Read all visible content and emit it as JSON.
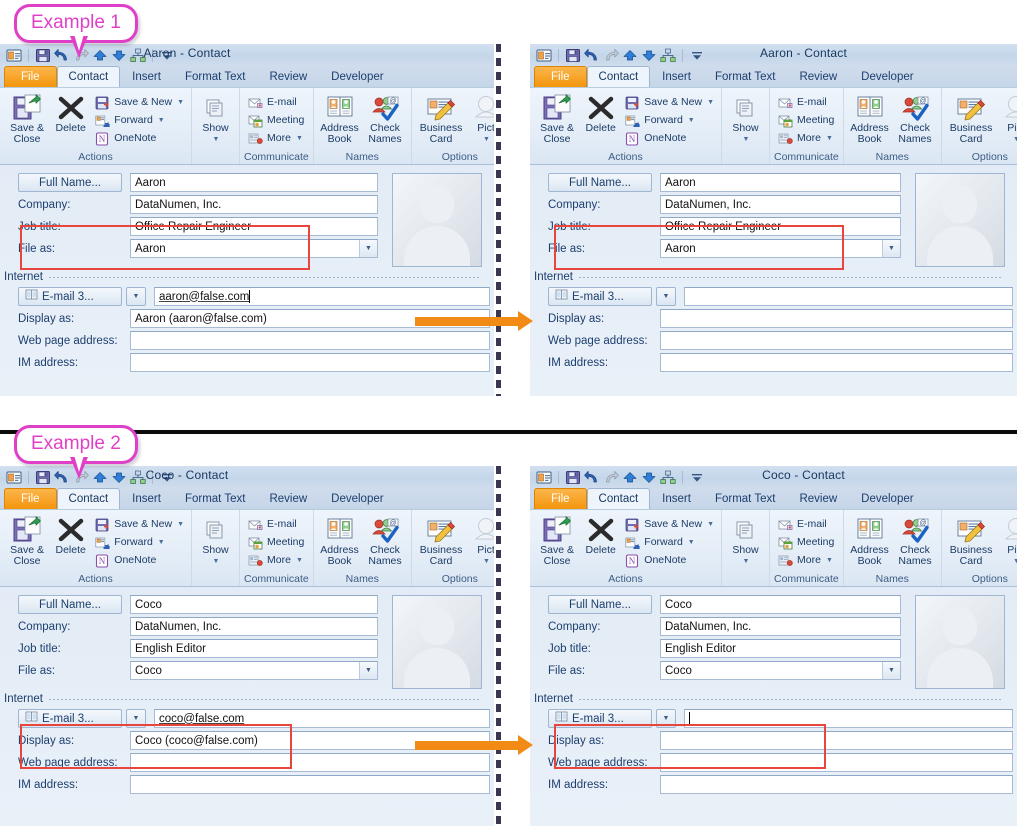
{
  "page": {
    "background": "#ffffff",
    "accent_orange": "#f28a16",
    "accent_magenta": "#e040c8",
    "highlight_red": "#e8453c"
  },
  "callouts": [
    {
      "label": "Example 1"
    },
    {
      "label": "Example 2"
    }
  ],
  "window_chrome": {
    "quick_access": [
      {
        "name": "contact-card-icon",
        "glyph": "contact"
      },
      {
        "name": "save-icon",
        "glyph": "save"
      },
      {
        "name": "undo-icon",
        "glyph": "undo"
      },
      {
        "name": "redo-icon",
        "glyph": "redo"
      },
      {
        "name": "previous-item-icon",
        "glyph": "up"
      },
      {
        "name": "next-item-icon",
        "glyph": "down"
      },
      {
        "name": "hierarchy-icon",
        "glyph": "hierarchy"
      },
      {
        "name": "customize-qat-icon",
        "glyph": "more"
      }
    ],
    "tabs": [
      {
        "label": "File",
        "style": "file"
      },
      {
        "label": "Contact",
        "style": "active"
      },
      {
        "label": "Insert",
        "style": "normal"
      },
      {
        "label": "Format Text",
        "style": "normal"
      },
      {
        "label": "Review",
        "style": "normal"
      },
      {
        "label": "Developer",
        "style": "normal"
      }
    ],
    "ribbon_groups": [
      {
        "label": "Actions",
        "big_buttons": [
          {
            "label_line1": "Save &",
            "label_line2": "Close",
            "icon": "save-and-close-icon"
          },
          {
            "label_line1": "Delete",
            "label_line2": "",
            "icon": "delete-icon"
          }
        ],
        "small_buttons": [
          {
            "label": "Save & New",
            "icon": "save-and-new-icon",
            "has_caret": true
          },
          {
            "label": "Forward",
            "icon": "forward-icon",
            "has_caret": true
          },
          {
            "label": "OneNote",
            "icon": "onenote-icon",
            "has_caret": false
          }
        ]
      },
      {
        "label": "",
        "big_buttons": [
          {
            "label_line1": "Show",
            "label_line2": "",
            "icon": "show-icon",
            "has_caret": true
          }
        ],
        "small_buttons": []
      },
      {
        "label": "Communicate",
        "big_buttons": [],
        "small_buttons": [
          {
            "label": "E-mail",
            "icon": "email-icon",
            "has_caret": false
          },
          {
            "label": "Meeting",
            "icon": "meeting-icon",
            "has_caret": false
          },
          {
            "label": "More",
            "icon": "more-icon",
            "has_caret": true
          }
        ]
      },
      {
        "label": "Names",
        "big_buttons": [
          {
            "label_line1": "Address",
            "label_line2": "Book",
            "icon": "address-book-icon"
          },
          {
            "label_line1": "Check",
            "label_line2": "Names",
            "icon": "check-names-icon"
          }
        ],
        "small_buttons": []
      },
      {
        "label": "Options",
        "big_buttons": [
          {
            "label_line1": "Business",
            "label_line2": "Card",
            "icon": "business-card-icon"
          },
          {
            "label_line1": "Pict",
            "label_line2": "",
            "icon": "picture-icon",
            "has_caret": true
          }
        ],
        "small_buttons": []
      }
    ],
    "form_labels": {
      "full_name": "Full Name...",
      "company": "Company:",
      "job_title": "Job title:",
      "file_as": "File as:",
      "internet_section": "Internet",
      "email_button": "E-mail 3...",
      "display_as": "Display as:",
      "web_page_address": "Web page address:",
      "im_address": "IM address:"
    }
  },
  "examples": [
    {
      "id": "example-1",
      "callout": "Example 1",
      "before": {
        "window_title": "Aaron  -  Contact",
        "full_name": "Aaron",
        "company": "DataNumen, Inc.",
        "job_title": "Office Repair Engineer",
        "file_as": "Aaron",
        "email": "aaron@false.com",
        "display_as": "Aaron (aaron@false.com)",
        "web_page_address": "",
        "im_address": "",
        "email_has_caret": true
      },
      "after": {
        "window_title": "Aaron  -  Contact",
        "full_name": "Aaron",
        "company": "DataNumen, Inc.",
        "job_title": "Office Repair Engineer",
        "file_as": "Aaron",
        "email": "",
        "display_as": "",
        "web_page_address": "",
        "im_address": "",
        "email_has_caret": false
      }
    },
    {
      "id": "example-2",
      "callout": "Example 2",
      "before": {
        "window_title": "Coco  -  Contact",
        "full_name": "Coco",
        "company": "DataNumen, Inc.",
        "job_title": "English Editor",
        "file_as": "Coco",
        "email": "coco@false.com",
        "display_as": "Coco (coco@false.com)",
        "web_page_address": "",
        "im_address": "",
        "email_has_caret": false
      },
      "after": {
        "window_title": "Coco  -  Contact",
        "full_name": "Coco",
        "company": "DataNumen, Inc.",
        "job_title": "English Editor",
        "file_as": "Coco",
        "email": "",
        "display_as": "",
        "web_page_address": "",
        "im_address": "",
        "email_has_caret": true
      }
    }
  ]
}
